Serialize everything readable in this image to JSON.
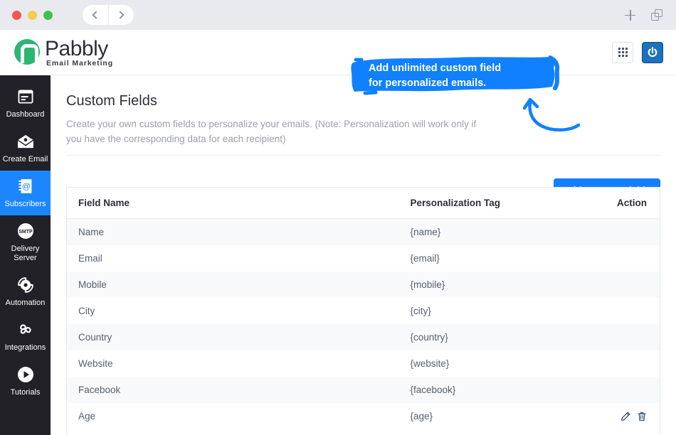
{
  "window": {
    "traffic_lights": [
      "red",
      "yellow",
      "green"
    ],
    "nav_back_icon": "chevron-left-icon",
    "nav_forward_icon": "chevron-right-icon",
    "new_tab_icon": "plus-icon",
    "tab_overview_icon": "stacked-windows-icon"
  },
  "header": {
    "logo_name": "Pabbly",
    "logo_sub": "Email Marketing",
    "apps_icon": "grid-apps-icon",
    "power_icon": "power-icon"
  },
  "sidebar": {
    "items": [
      {
        "label": "Dashboard",
        "icon": "dashboard-icon",
        "active": false
      },
      {
        "label": "Create Email",
        "icon": "envelope-icon",
        "active": false
      },
      {
        "label": "Subscribers",
        "icon": "address-book-icon",
        "active": true
      },
      {
        "label": "Delivery Server",
        "icon": "smtp-icon",
        "active": false
      },
      {
        "label": "Automation",
        "icon": "gear-automation-icon",
        "active": false
      },
      {
        "label": "Integrations",
        "icon": "integrations-nodes-icon",
        "active": false
      },
      {
        "label": "Tutorials",
        "icon": "play-circle-icon",
        "active": false
      }
    ],
    "active_color": "#1c86ff",
    "background": "#212127"
  },
  "main": {
    "title": "Custom Fields",
    "description": "Create your own custom fields to personalize your emails. (Note: Personalization will work only if you have the corresponding data for each recipient)",
    "add_button_label": "Add Custom Fields",
    "add_button_color": "#1080ff"
  },
  "callout": {
    "line1": "Add unlimited custom field",
    "line2": "for personalized emails.",
    "color": "#1080ff",
    "arrow_icon": "curved-arrow-icon"
  },
  "table": {
    "columns": [
      "Field Name",
      "Personalization Tag",
      "Action"
    ],
    "rows": [
      {
        "field_name": "Name",
        "tag": "{name}",
        "has_actions": false
      },
      {
        "field_name": "Email",
        "tag": "{email}",
        "has_actions": false
      },
      {
        "field_name": "Mobile",
        "tag": "{mobile}",
        "has_actions": false
      },
      {
        "field_name": "City",
        "tag": "{city}",
        "has_actions": false
      },
      {
        "field_name": "Country",
        "tag": "{country}",
        "has_actions": false
      },
      {
        "field_name": "Website",
        "tag": "{website}",
        "has_actions": false
      },
      {
        "field_name": "Facebook",
        "tag": "{facebook}",
        "has_actions": false
      },
      {
        "field_name": "Age",
        "tag": "{age}",
        "has_actions": true
      }
    ],
    "action_icons": [
      "edit-pencil-icon",
      "delete-trash-icon"
    ]
  }
}
